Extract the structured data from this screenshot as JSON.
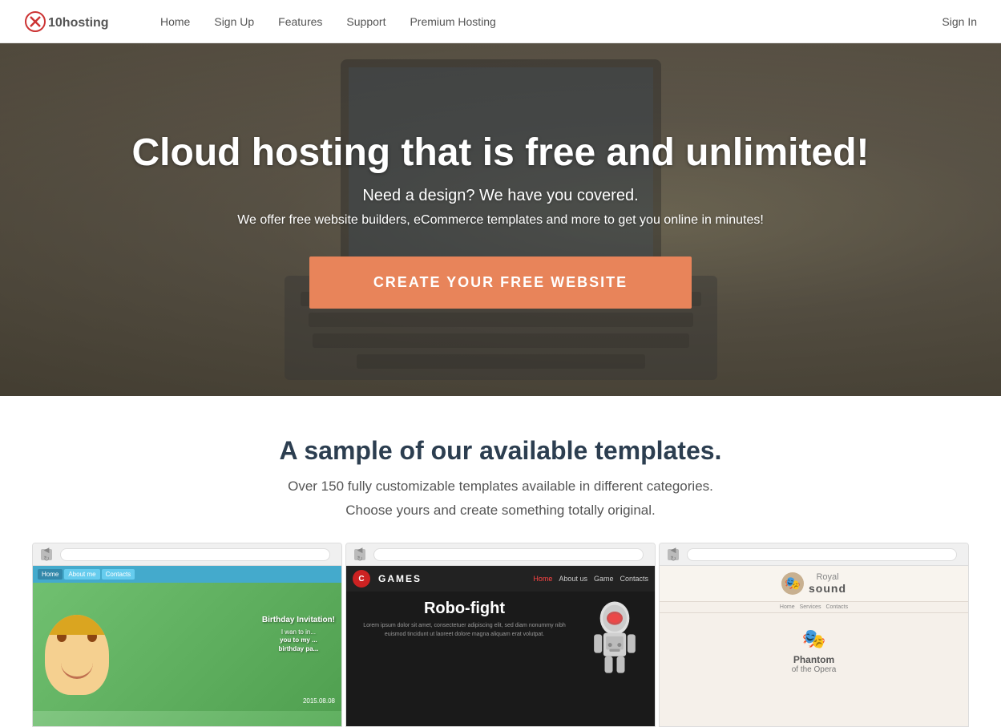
{
  "brand": {
    "name": "x10hosting",
    "logo_text": "x10hosting"
  },
  "nav": {
    "links": [
      {
        "label": "Home",
        "id": "home"
      },
      {
        "label": "Sign Up",
        "id": "signup"
      },
      {
        "label": "Features",
        "id": "features"
      },
      {
        "label": "Support",
        "id": "support"
      },
      {
        "label": "Premium Hosting",
        "id": "premium"
      }
    ],
    "signin_label": "Sign In"
  },
  "hero": {
    "title": "Cloud hosting that is free and unlimited!",
    "subtitle": "Need a design? We have you covered.",
    "description": "We offer free website builders, eCommerce templates and more to get you online in minutes!",
    "cta_label": "CREATE YOUR FREE WEBSITE"
  },
  "templates_section": {
    "title": "A sample of our available templates.",
    "subtitle": "Over 150 fully customizable templates available in different categories.",
    "subtitle2": "Choose yours and create something totally original."
  },
  "template_previews": [
    {
      "id": "birthday",
      "nav_items": [
        "Home",
        "About me",
        "Contacts"
      ],
      "title": "Birthday Invitation!",
      "text_lines": [
        "I wan to in...",
        "you to my ...",
        "birthday pa..."
      ],
      "date": "2015.08.08"
    },
    {
      "id": "games",
      "brand": "GAMES",
      "logo_letter": "C",
      "nav_items": [
        "Home",
        "About us",
        "Game",
        "Contacts"
      ],
      "active_nav": "Home",
      "hero_title": "Robo-fight",
      "lorem": "Lorem ipsum dolor sit amet, consectetuer adipiscing elit, sed diam nonummy nibh euismod tincidunt ut laoreet dolore magna aliquam erat volutpat."
    },
    {
      "id": "royal",
      "brand_sub": "Royal",
      "brand_main": "sound",
      "nav_items": [
        "Home",
        "Services",
        "Contacts"
      ],
      "hero_title": "Phantom",
      "hero_sub": "of the Opera"
    }
  ],
  "colors": {
    "cta_orange": "#e8845a",
    "nav_bg": "#ffffff",
    "hero_overlay": "rgba(60,55,40,0.6)",
    "section_title": "#2c3e50",
    "games_accent": "#cc2222"
  }
}
